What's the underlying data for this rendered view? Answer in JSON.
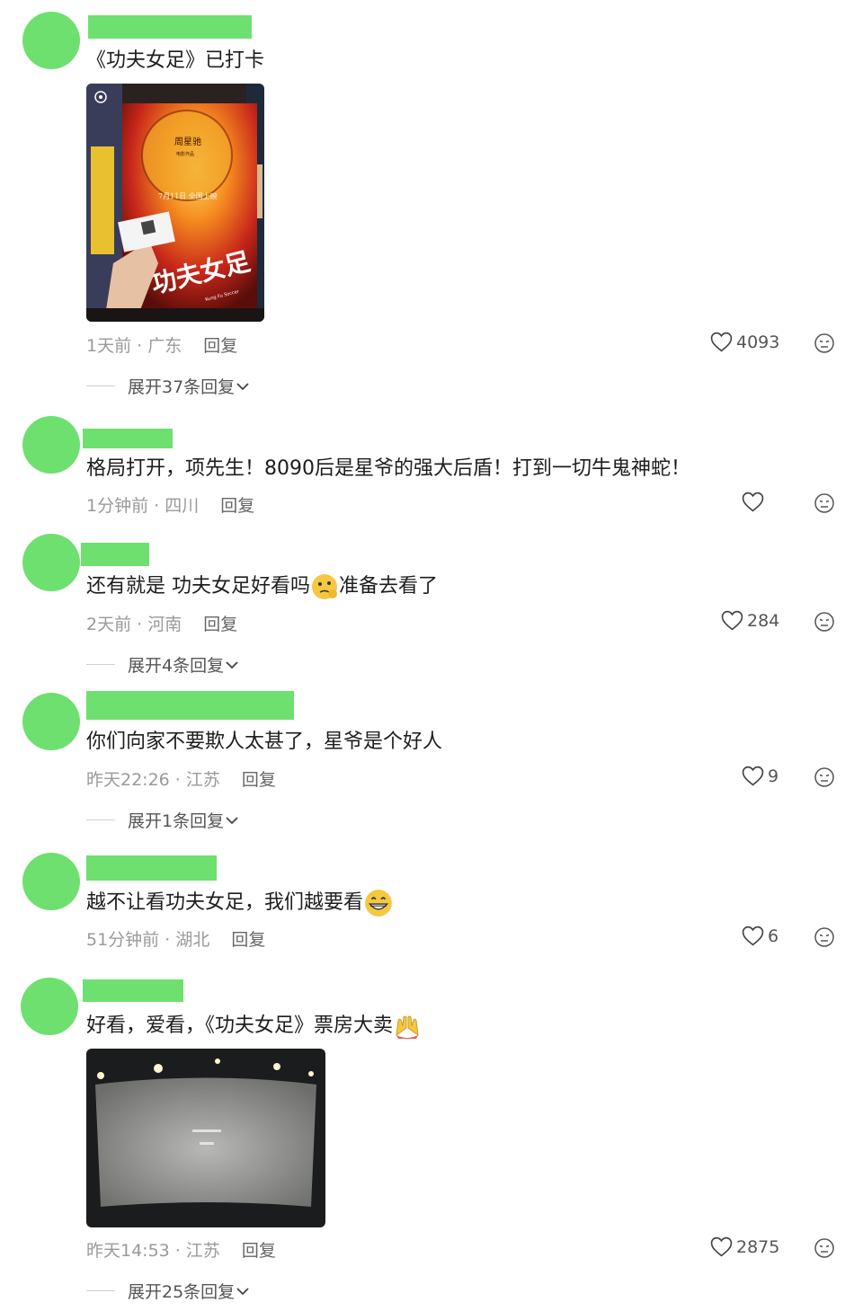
{
  "comments": [
    {
      "text": "《功夫女足》已打卡",
      "time": "1天前",
      "location": "广东",
      "reply": "回复",
      "likes": "4093",
      "expand": "展开37条回复"
    },
    {
      "text": "格局打开，项先生！8090后是星爷的强大后盾！打到一切牛鬼神蛇！",
      "time": "1分钟前",
      "location": "四川",
      "reply": "回复",
      "likes": ""
    },
    {
      "text_before": "还有就是 功夫女足好看吗",
      "text_after": "准备去看了",
      "time": "2天前",
      "location": "河南",
      "reply": "回复",
      "likes": "284",
      "expand": "展开4条回复"
    },
    {
      "text": "你们向家不要欺人太甚了，星爷是个好人",
      "time": "昨天22:26",
      "location": "江苏",
      "reply": "回复",
      "likes": "9",
      "expand": "展开1条回复"
    },
    {
      "text": "越不让看功夫女足，我们越要看",
      "time": "51分钟前",
      "location": "湖北",
      "reply": "回复",
      "likes": "6"
    },
    {
      "text": "好看，爱看，《功夫女足》票房大卖",
      "time": "昨天14:53",
      "location": "江苏",
      "reply": "回复",
      "likes": "2875",
      "expand": "展开25条回复"
    }
  ],
  "poster": {
    "director": "周星驰",
    "director_sub": "电影作品",
    "release": "7月11日 全国上映",
    "title": "功夫女足",
    "subtitle": "Kung Fu Soccer"
  },
  "colors": {
    "avatar": "#6ee070",
    "meta": "#9a9a9a",
    "text": "#1d1d1d"
  },
  "icons": [
    "heart-icon",
    "dislike-face-icon",
    "chevron-down-icon"
  ]
}
